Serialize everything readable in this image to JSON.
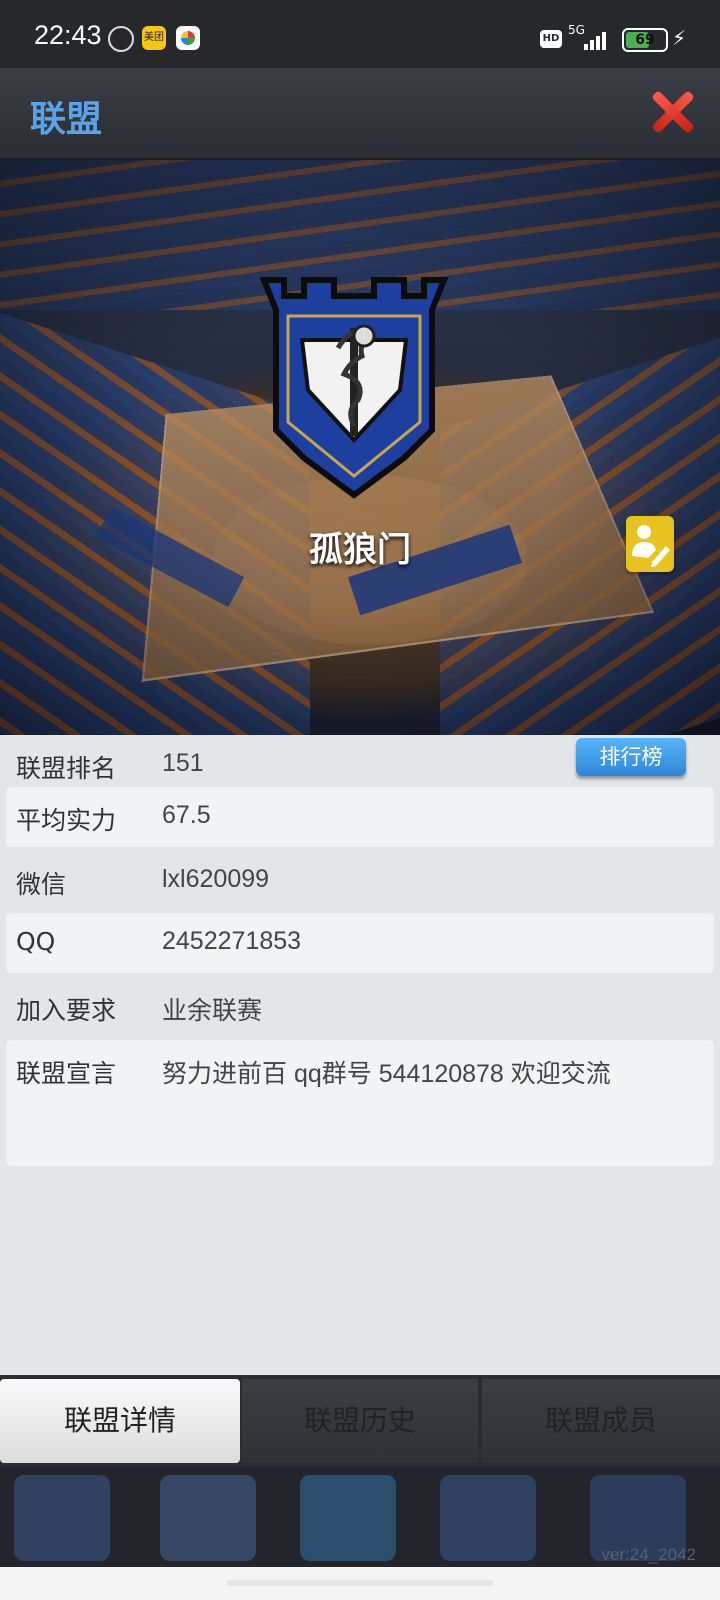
{
  "status_bar": {
    "time": "22:43",
    "meituan_label": "美团",
    "hd_label": "HD",
    "network": "5G",
    "battery": "69",
    "battery_level_percent": 69
  },
  "header": {
    "title": "联盟"
  },
  "team": {
    "name": "孤狼门"
  },
  "info": {
    "rank_label": "联盟排名",
    "rank_value": "151",
    "rank_button": "排行榜",
    "power_label": "平均实力",
    "power_value": "67.5",
    "wechat_label": "微信",
    "wechat_value": "lxl620099",
    "qq_label": "QQ",
    "qq_value": "2452271853",
    "join_label": "加入要求",
    "join_value": "业余联赛",
    "manifesto_label": "联盟宣言",
    "manifesto_value": "努力进前百 qq群号 544120878 欢迎交流"
  },
  "tabs": [
    "联盟详情",
    "联盟历史",
    "联盟成员"
  ],
  "footer": {
    "version": "ver:24_2042"
  },
  "colors": {
    "header_title": "#5aa3e6",
    "rank_button": "#3a97e6",
    "edit_button": "#e8c31f",
    "close": "#e0352a"
  }
}
